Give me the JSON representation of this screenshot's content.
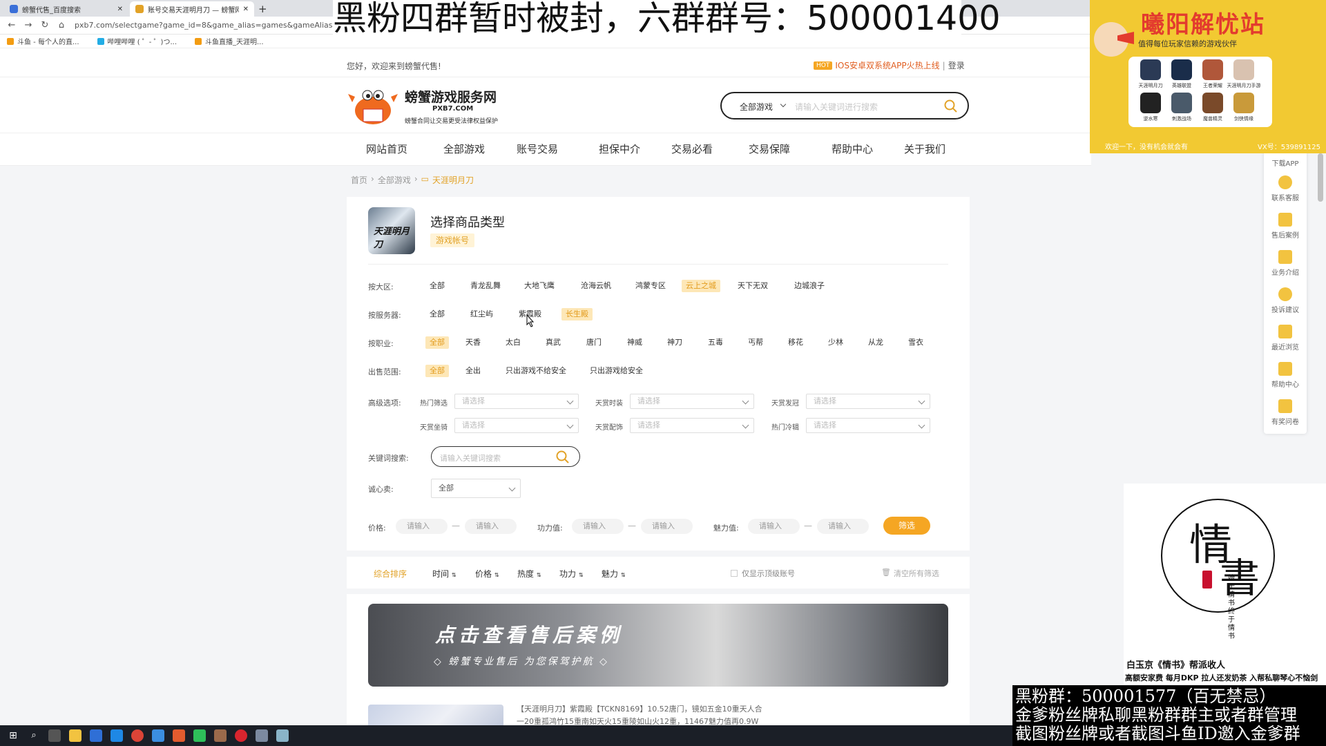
{
  "browser": {
    "tabs": [
      {
        "title": "螃蟹代售_百度搜索",
        "active": false
      },
      {
        "title": "账号交易天涯明月刀 — 螃蟹网络",
        "active": true
      }
    ],
    "new_tab": "+",
    "url": "pxb7.com/selectgame?game_id=8&game_alias=games&gameAlias=t",
    "bookmarks": [
      "斗鱼 - 每个人的直...",
      "哔哩哔哩 ( ゜- ゜)つ...",
      "斗鱼直播_天涯明..."
    ]
  },
  "site": {
    "welcome": "您好，欢迎来到螃蟹代售!",
    "hot_badge": "HOT",
    "hot_link": "IOS安卓双系统APP火热上线",
    "login": "登录",
    "logo_name": "螃蟹游戏服务网",
    "logo_domain": "PXB7.COM",
    "logo_slogan": "螃蟹合同让交易更受法律权益保护",
    "search_scope": "全部游戏",
    "search_placeholder": "请输入关键词进行搜索",
    "nav": [
      "网站首页",
      "全部游戏",
      "账号交易",
      "担保中介",
      "交易必看",
      "交易保障",
      "帮助中心",
      "关于我们"
    ],
    "breadcrumb": [
      "首页",
      "全部游戏",
      "天涯明月刀"
    ]
  },
  "filters": {
    "icon_text": "天涯明月刀",
    "title": "选择商品类型",
    "badge": "游戏帐号",
    "region_label": "按大区:",
    "regions": [
      "全部",
      "青龙乱舞",
      "大地飞鹰",
      "沧海云帆",
      "鸿蒙专区",
      "云上之城",
      "天下无双",
      "边城浪子"
    ],
    "region_selected": 5,
    "server_label": "按服务器:",
    "servers": [
      "全部",
      "红尘屿",
      "紫霞殿",
      "长生殿"
    ],
    "server_selected": 3,
    "class_label": "按职业:",
    "classes": [
      "全部",
      "天香",
      "太白",
      "真武",
      "唐门",
      "神威",
      "神刀",
      "五毒",
      "丐帮",
      "移花",
      "少林",
      "从龙",
      "雪衣"
    ],
    "class_selected": 0,
    "sale_label": "出售范围:",
    "sales": [
      "全部",
      "全出",
      "只出游戏不给安全",
      "只出游戏给安全"
    ],
    "sale_selected": 0,
    "advanced_label": "高级选项:",
    "adv": [
      {
        "label": "热门筛选",
        "placeholder": "请选择"
      },
      {
        "label": "天赏时装",
        "placeholder": "请选择"
      },
      {
        "label": "天赏发冠",
        "placeholder": "请选择"
      },
      {
        "label": "天赏坐骑",
        "placeholder": "请选择"
      },
      {
        "label": "天赏配饰",
        "placeholder": "请选择"
      },
      {
        "label": "热门冷辑",
        "placeholder": "请选择"
      }
    ],
    "keyword_label": "关键词搜索:",
    "keyword_placeholder": "请输入关键词搜索",
    "seller_label": "诚心卖:",
    "seller_value": "全部",
    "price_label": "价格:",
    "power_label": "功力值:",
    "charm_label": "魅力值:",
    "range_placeholder": "请输入",
    "dash": "—",
    "filter_button": "筛选"
  },
  "sort": {
    "items": [
      "综合排序",
      "时间",
      "价格",
      "热度",
      "功力",
      "魅力"
    ],
    "top_only": "仅显示顶级账号",
    "clear": "清空所有筛选"
  },
  "listing": {
    "banner_title": "点击查看售后案例",
    "banner_sub": "◇ 螃蟹专业售后 为您保驾护航 ◇",
    "item_line1": "【天涯明月刀】紫霞殿【TCKN8169】10.52唐门，镜如五金10重天人合",
    "item_line2": "一20重孤鸿竹15重南如天火15重陵如山火12重，11467魅力值再0.9W"
  },
  "sidebar": [
    "下载APP",
    "联系客服",
    "售后案例",
    "业务介绍",
    "投诉建议",
    "最近浏览",
    "帮助中心",
    "有奖问卷"
  ],
  "overlays": {
    "top_banner": "黑粉四群暂时被封，六群群号：500001400",
    "promo_title": "曦阳解忧站",
    "promo_sub": "值得每位玩家信赖的游戏伙伴",
    "promo_games": [
      "天涯明月刀",
      "英雄联盟",
      "王者荣耀",
      "天涯明月刀手游",
      "逆水寒",
      "刺激战场",
      "魔兽精灵",
      "剑侠情缘"
    ],
    "promo_note": "欢迎一下，没有机会就会有",
    "promo_contact": "VX号：539891125",
    "qingshu_big1": "情",
    "qingshu_big2": "書",
    "qingshu_vert": "始于情书终于情书",
    "qingshu_cap1": "白玉京《情书》帮派收人",
    "qingshu_cap2": "高额安家费 每月DKP 拉人还发奶茶 入帮私聊琴心不恼剑",
    "black_lines": [
      "黑粉群：500001577（百无禁忌）",
      "金爹粉丝牌私聊黑粉群群主或者群管理",
      "截图粉丝牌或者截图斗鱼ID邀入金爹群"
    ]
  },
  "colors": {
    "accent": "#e2a227",
    "chip_bg": "#fde7b7",
    "button": "#f5a623",
    "promo_bg": "#f2c932"
  }
}
